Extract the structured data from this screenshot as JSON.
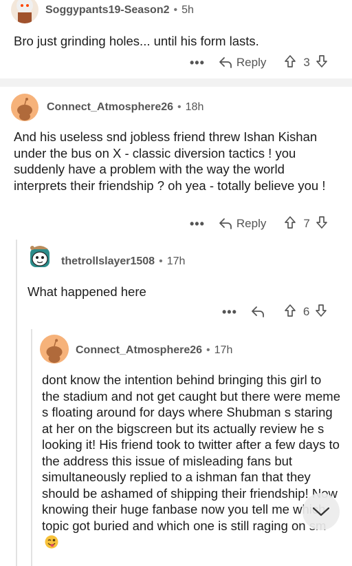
{
  "comments": [
    {
      "username": "Soggypants19-Season2",
      "time": "5h",
      "body": "Bro just grinding holes... until his form lasts.",
      "reply_label": "Reply",
      "votes": "3"
    },
    {
      "username": "Connect_Atmosphere26",
      "time": "18h",
      "body": "And his useless snd jobless friend threw Ishan Kishan under the bus on X - classic diversion tactics ! you suddenly have a problem with the way the world interprets their friendship ? oh yea - totally believe you !",
      "reply_label": "Reply",
      "votes": "7"
    },
    {
      "username": "thetrollslayer1508",
      "time": "17h",
      "body": "What happened here",
      "votes": "6"
    },
    {
      "username": "Connect_Atmosphere26",
      "time": "17h",
      "body": "dont know the intention behind bringing this girl to the stadium and not get caught but there were meme s floating around for days where Shubman s staring at her on the bigscreen but its actually review he s looking it! His friend took to twitter after a few days to the address this issue of misleading fans but simultaneously replied to a ishman fan that they should be ashamed of shipping their friendship! Now knowing their huge fanbase now you tell me which topic got buried and which one is still raging on sm"
    }
  ],
  "separator_dot": "•",
  "more_label": "•••",
  "colors": {
    "text": "#1c1c1c",
    "meta": "#555555",
    "orange_avatar": "#f4a460",
    "separator": "#f2f2f2"
  }
}
